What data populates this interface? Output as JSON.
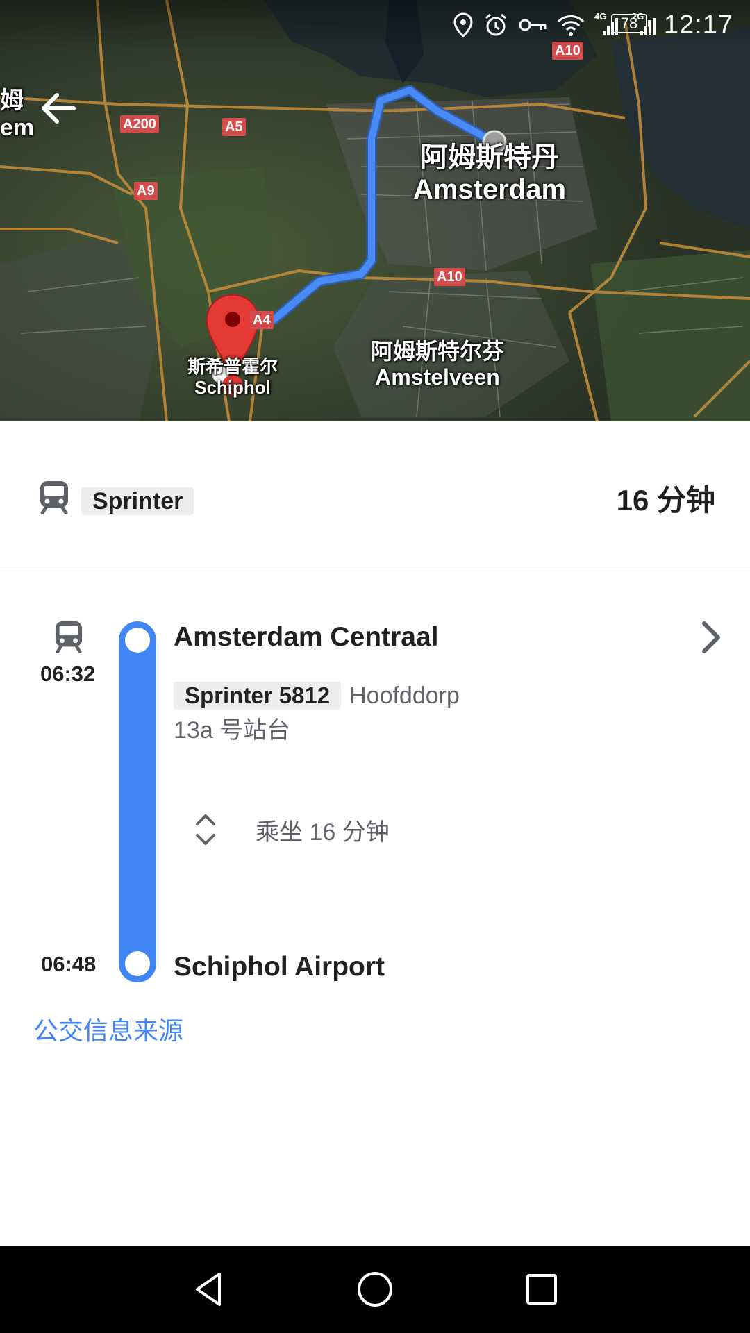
{
  "status_bar": {
    "network_1": "4G",
    "network_2": "2G",
    "battery": "78",
    "time": "12:17"
  },
  "map": {
    "labels": {
      "amsterdam_zh": "阿姆斯特丹",
      "amsterdam_en": "Amsterdam",
      "amstelveen_zh": "阿姆斯特尔芬",
      "amstelveen_en": "Amstelveen",
      "schiphol_zh": "斯希普霍尔",
      "schiphol_en": "Schiphol",
      "left_edge_zh": "姆",
      "left_edge_en": "em"
    },
    "roads": [
      "A200",
      "A5",
      "A9",
      "A10",
      "A10",
      "A4"
    ],
    "route_color": "#4285f4",
    "pin_color": "#e53935"
  },
  "summary": {
    "icon": "train-icon",
    "line_chip": "Sprinter",
    "duration": "16 分钟"
  },
  "timeline": {
    "departure": {
      "time": "06:32",
      "station": "Amsterdam Centraal",
      "line_chip": "Sprinter 5812",
      "headsign": "Hoofddorp",
      "platform": "13a 号站台"
    },
    "ride": {
      "label": "乘坐 16 分钟",
      "icon": "expand-icon"
    },
    "arrival": {
      "time": "06:48",
      "station": "Schiphol Airport"
    },
    "rail_color": "#4285f4"
  },
  "source_link": "公交信息来源",
  "nav_bar": {
    "back": "back-triangle-icon",
    "home": "home-circle-icon",
    "recents": "recents-square-icon"
  }
}
